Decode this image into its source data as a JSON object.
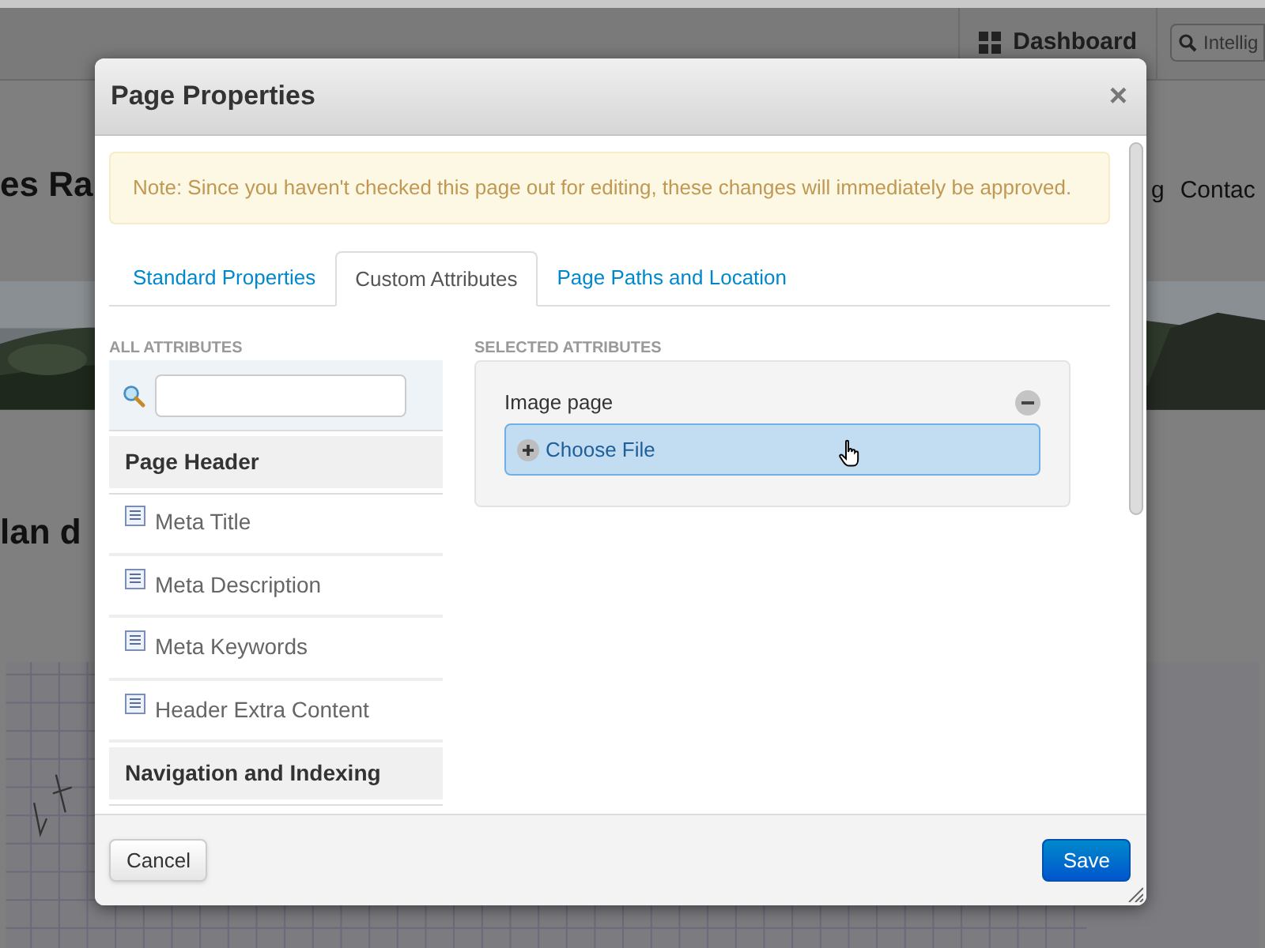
{
  "background_page": {
    "toolbar": {
      "dashboard": "Dashboard",
      "search_placeholder": "Intellig"
    },
    "site_title": "es Ra",
    "nav_items": [
      "g",
      "Contac"
    ],
    "heading": "lan d",
    "banner": {
      "kind": "picture"
    },
    "sketch": {
      "kind": "picture"
    }
  },
  "dialog": {
    "title": "Page Properties",
    "close": "×",
    "note": "Note: Since you haven't checked this page out for editing, these changes will immediately be approved.",
    "tabs": [
      {
        "label": "Standard Properties",
        "selected": false
      },
      {
        "label": "Custom Attributes",
        "selected": true
      },
      {
        "label": "Page Paths and Location",
        "selected": false
      }
    ],
    "all_attributes": {
      "heading": "ALL ATTRIBUTES",
      "groups": [
        {
          "name": "Page Header",
          "items": [
            "Meta Title",
            "Meta Description",
            "Meta Keywords",
            "Header Extra Content"
          ]
        },
        {
          "name": "Navigation and Indexing"
        }
      ]
    },
    "selected_attributes": {
      "heading": "SELECTED ATTRIBUTES",
      "attributes": [
        {
          "label": "Image page",
          "button": "Choose File"
        }
      ]
    },
    "buttons": {
      "cancel": "Cancel",
      "save": "Save"
    }
  }
}
